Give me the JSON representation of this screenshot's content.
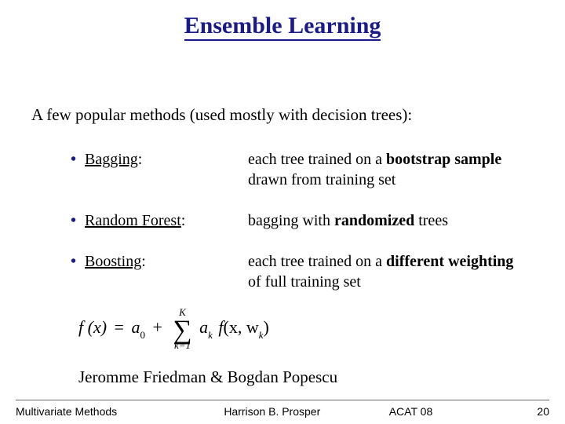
{
  "title": "Ensemble Learning",
  "intro": "A few popular methods (used mostly with decision trees):",
  "methods": [
    {
      "name": "Bagging",
      "desc_pre": "each tree trained on a ",
      "desc_bold": "bootstrap sample",
      "desc_post": " drawn from training set"
    },
    {
      "name": "Random Forest",
      "desc_pre": "bagging with ",
      "desc_bold": "randomized",
      "desc_post": " trees"
    },
    {
      "name": "Boosting",
      "desc_pre": "each tree trained on a ",
      "desc_bold": "different weighting",
      "desc_post": " of full training set"
    }
  ],
  "formula": {
    "lhs": "f (x)",
    "eq": "=",
    "a0": "a",
    "a0_sub": "0",
    "plus": "+",
    "sum_top": "K",
    "sum_bot": "k=1",
    "ak": "a",
    "ak_sub": "k",
    "f": "f",
    "args_open": "(x, w",
    "wk_sub": "k",
    "args_close": ")"
  },
  "attribution": "Jeromme Friedman & Bogdan Popescu",
  "footer": {
    "left": "Multivariate Methods",
    "center": "Harrison B. Prosper",
    "right1": "ACAT 08",
    "page": "20"
  }
}
